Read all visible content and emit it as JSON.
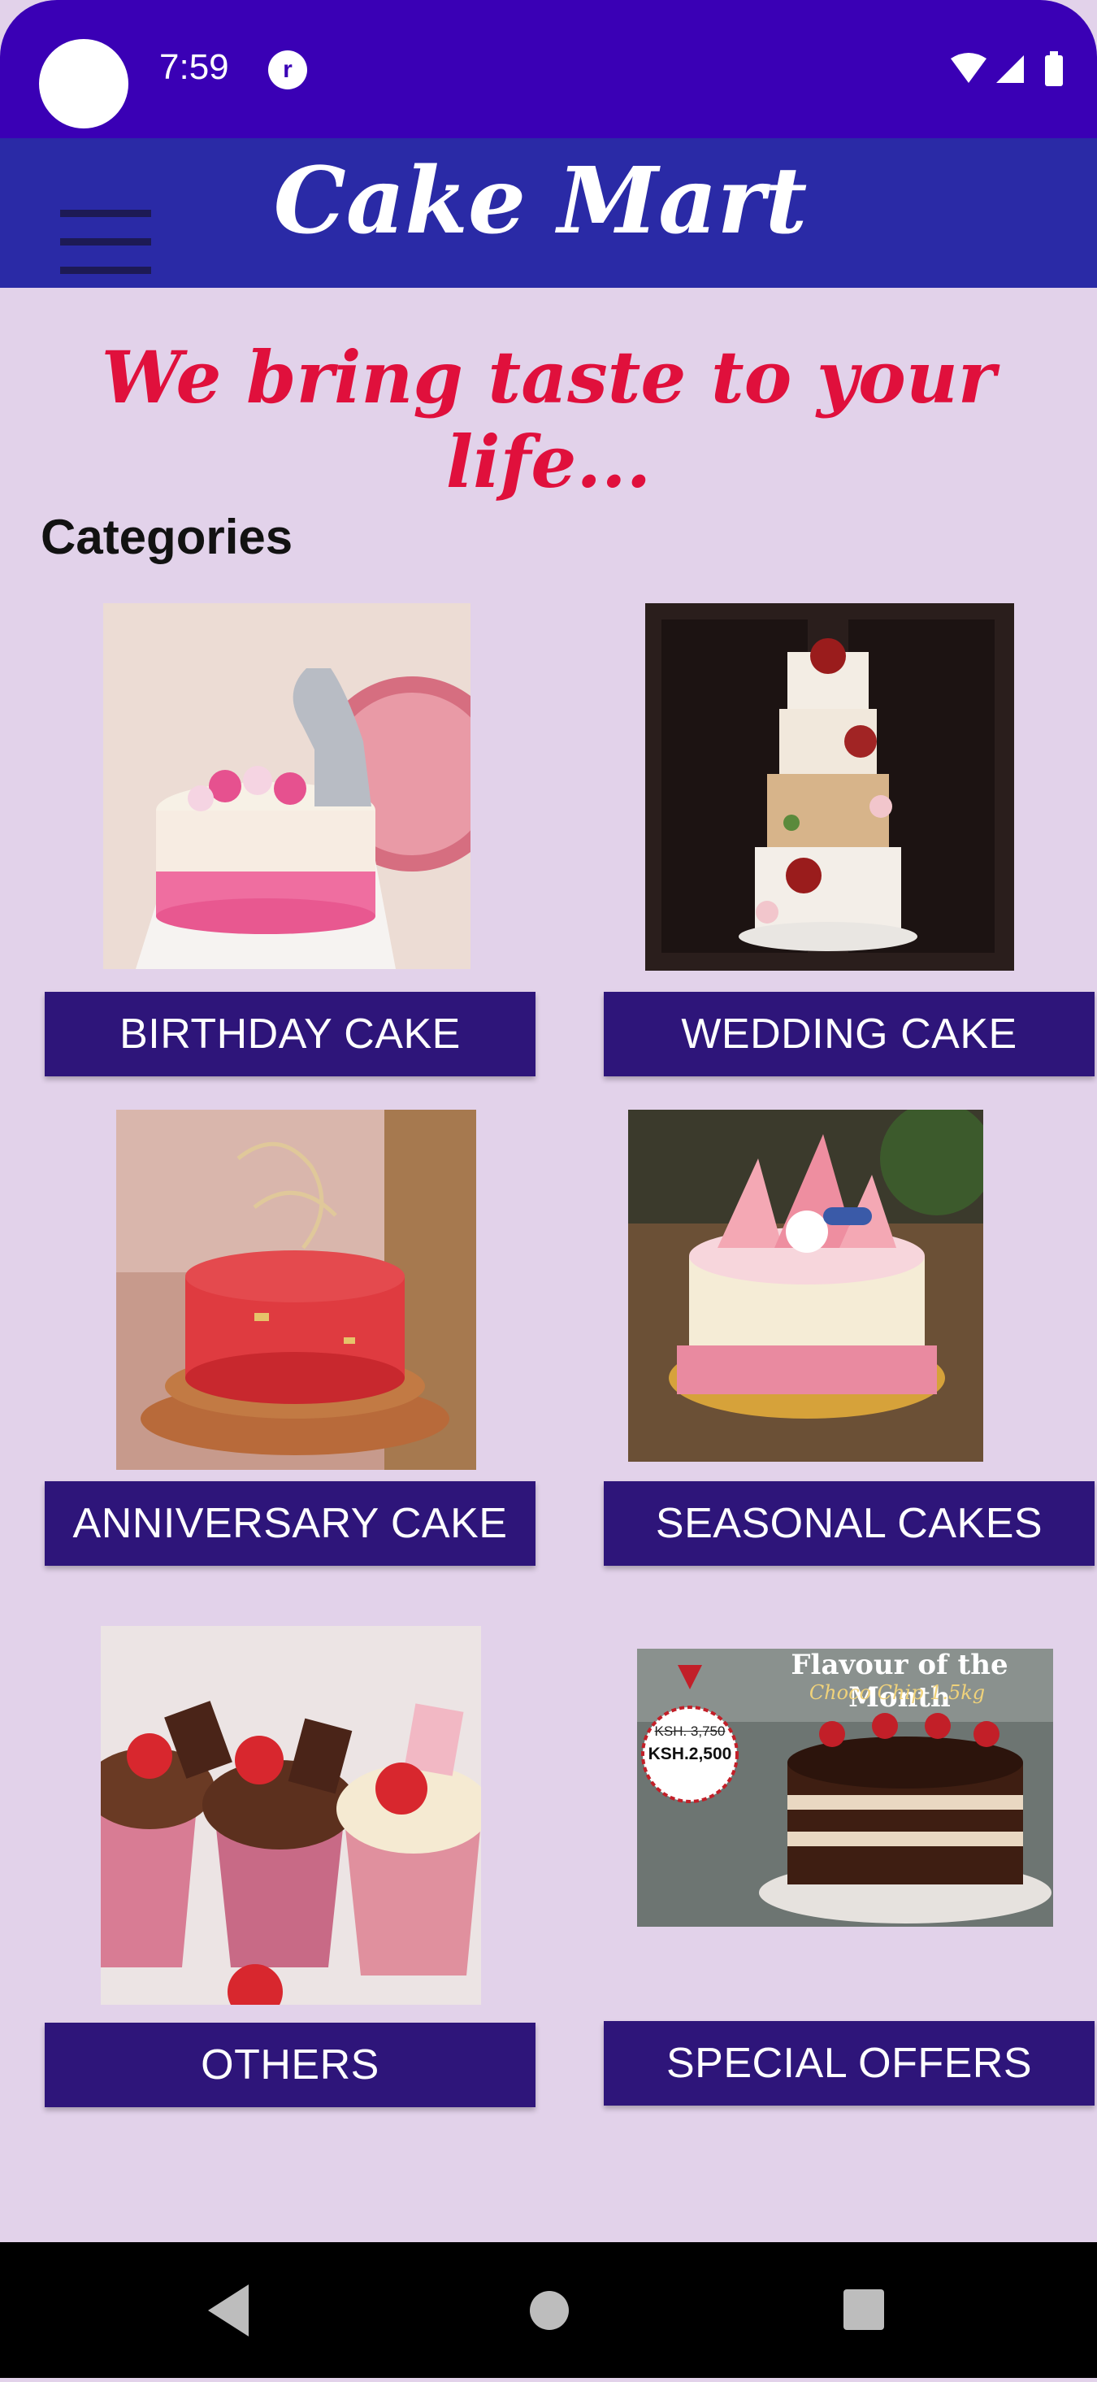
{
  "status_bar": {
    "time": "7:59",
    "badge_letter": "r",
    "color": "#3a00b5"
  },
  "app_bar": {
    "title": "Cake Mart",
    "menu_icon": "hamburger-menu-icon",
    "color": "#2a2aa6"
  },
  "tagline": "We bring taste to your life...",
  "section_title": "Categories",
  "categories": [
    {
      "label": "BIRTHDAY CAKE"
    },
    {
      "label": "WEDDING CAKE"
    },
    {
      "label": "ANNIVERSARY CAKE"
    },
    {
      "label": "SEASONAL CAKES"
    },
    {
      "label": "OTHERS"
    },
    {
      "label": "SPECIAL OFFERS"
    }
  ],
  "offer_image": {
    "headline": "Flavour of the Month",
    "subline": "Choco Chip 1.5kg",
    "old_price": "KSH. 3,750",
    "new_price": "KSH.2,500"
  },
  "nav_bar": {
    "icons": [
      "back-icon",
      "home-icon",
      "recents-icon"
    ]
  },
  "colors": {
    "background": "#e2d2ea",
    "button": "#2e157a",
    "tagline": "#e0103c"
  }
}
